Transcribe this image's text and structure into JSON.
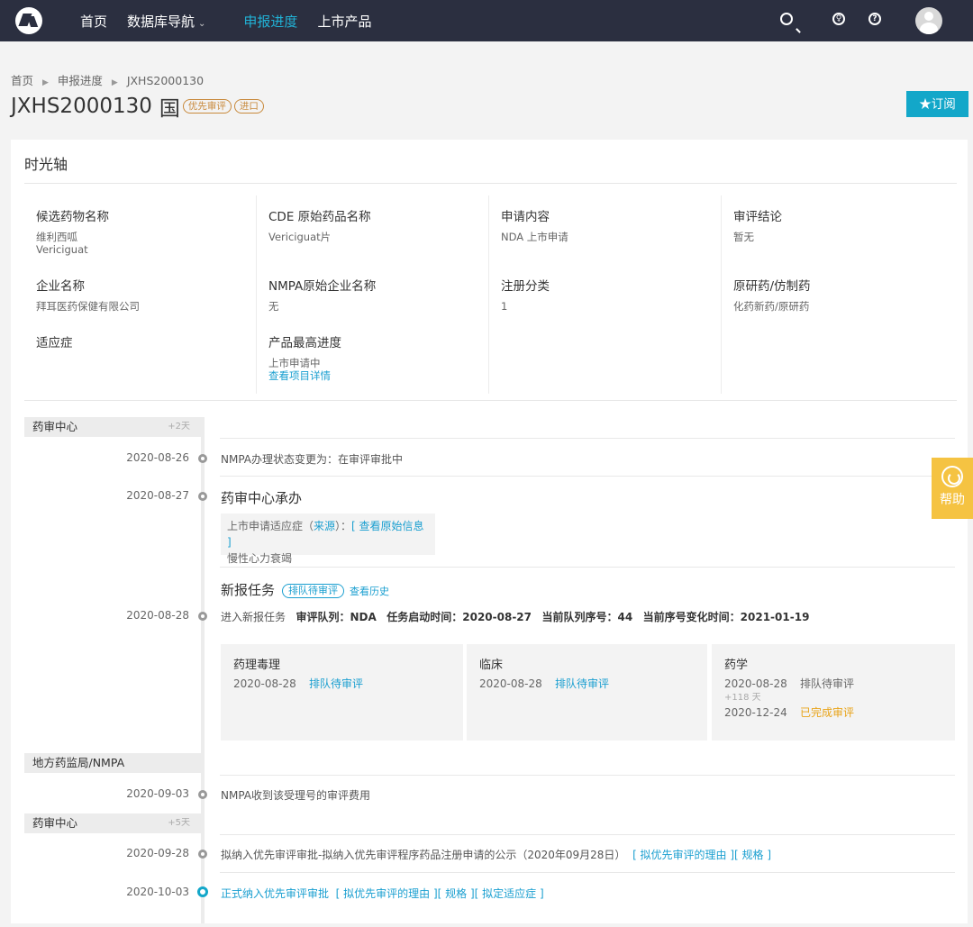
{
  "nav": {
    "items": [
      "首页",
      "数据库导航"
    ],
    "active": "申报进度",
    "products": "上市产品",
    "caret": "⌄"
  },
  "breadcrumb": [
    "首页",
    "申报进度",
    "JXHS2000130"
  ],
  "title": {
    "code": "JXHS2000130",
    "region": "国",
    "badges": [
      "优先审评",
      "进口"
    ]
  },
  "subscribe_label": "★订阅",
  "card_title": "时光轴",
  "info": {
    "drug_name_label": "候选药物名称",
    "drug_name_cn": "维利西呱",
    "drug_name_en": "Vericiguat",
    "cde_name_label": "CDE 原始药品名称",
    "cde_name": "Vericiguat片",
    "apply_label": "申请内容",
    "apply": "NDA  上市申请",
    "conclusion_label": "审评结论",
    "conclusion": "暂无",
    "company_label": "企业名称",
    "company": "拜耳医药保健有限公司",
    "nmpa_company_label": "NMPA原始企业名称",
    "nmpa_company": "无",
    "reg_class_label": "注册分类",
    "reg_class": "1",
    "origin_label": "原研药/仿制药",
    "origin": "化药新药/原研药",
    "indication_label": "适应症",
    "progress_label": "产品最高进度",
    "progress": "上市申请中",
    "progress_link": "查看项目详情"
  },
  "timeline": {
    "sections": [
      {
        "name": "药审中心",
        "plus": "+2天"
      },
      {
        "name": "地方药监局/NMPA",
        "plus": ""
      },
      {
        "name": "药审中心",
        "plus": "+5天"
      }
    ],
    "e1": {
      "date": "2020-08-26",
      "text": "NMPA办理状态变更为：在审评审批中"
    },
    "e2": {
      "date": "2020-08-27",
      "heading": "药审中心承办",
      "note_prefix": "上市申请适应症（",
      "note_src": "来源",
      "note_mid": "）：",
      "note_link": "[ 查看原始信息 ]",
      "note_text": "慢性心力衰竭"
    },
    "e3": {
      "heading": "新报任务",
      "tag": "排队待审评",
      "history": "查看历史",
      "date": "2020-08-28",
      "text_prefix": "进入新报任务",
      "queue_label": "审评队列：",
      "queue": "NDA",
      "start_label": "任务启动时间：",
      "start": "2020-08-27",
      "seq_label": "当前队列序号：",
      "seq": "44",
      "seqchg_label": "当前序号变化时间：",
      "seqchg": "2021-01-19"
    },
    "tasks": [
      {
        "title": "药理毒理",
        "date": "2020-08-28",
        "status": "排队待审评"
      },
      {
        "title": "临床",
        "date": "2020-08-28",
        "status": "排队待审评"
      },
      {
        "title": "药学",
        "date": "2020-08-28",
        "status": "排队待审评",
        "extra": "+118 天",
        "date2": "2020-12-24",
        "status2": "已完成审评"
      }
    ],
    "e4": {
      "date": "2020-09-03",
      "text": "NMPA收到该受理号的审评费用"
    },
    "e5": {
      "date": "2020-09-28",
      "text": "拟纳入优先审评审批-拟纳入优先审评程序药品注册申请的公示（2020年09月28日）",
      "links": "[ 拟优先审评的理由 ][ 规格 ]"
    },
    "e6": {
      "date": "2020-10-03",
      "text": "正式纳入优先审评审批",
      "links": "[ 拟优先审评的理由 ][ 规格 ][ 拟定适应症 ]"
    }
  },
  "help_label": "帮助",
  "colors": {
    "nav_bg": "#2b2f40",
    "accent": "#13a7c9",
    "badge": "#c8893b",
    "help": "#f5c342",
    "done": "#e8a317"
  }
}
